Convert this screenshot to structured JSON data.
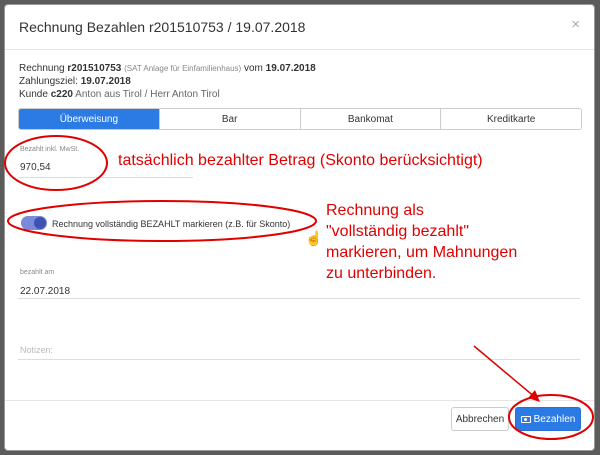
{
  "dialog": {
    "title": "Rechnung Bezahlen r201510753 / 19.07.2018",
    "close_glyph": "×"
  },
  "info": {
    "invoice_prefix": "Rechnung ",
    "invoice_number": "r201510753",
    "invoice_desc": "(SAT Anlage für Einfamilienhaus)",
    "invoice_from": " vom ",
    "invoice_date": "19.07.2018",
    "due_label": "Zahlungsziel: ",
    "due_date": "19.07.2018",
    "customer_label": "Kunde ",
    "customer_id": "c220",
    "customer_name": " Anton aus Tirol / Herr Anton Tirol"
  },
  "tabs": [
    {
      "label": "Überweisung",
      "active": true
    },
    {
      "label": "Bar",
      "active": false
    },
    {
      "label": "Bankomat",
      "active": false
    },
    {
      "label": "Kreditkarte",
      "active": false
    }
  ],
  "form": {
    "amount_label": "Bezahlt inkl. MwSt.",
    "amount_value": "970,54",
    "toggle_label": "Rechnung vollständig BEZAHLT markieren (z.B. für Skonto)",
    "toggle_on": true,
    "paid_on_label": "bezahlt am",
    "paid_on_value": "22.07.2018",
    "notes_placeholder": "Notizen:"
  },
  "annotations": {
    "amount_note": "tatsächlich bezahlter Betrag (Skonto berücksichtigt)",
    "toggle_note_1": "Rechnung als",
    "toggle_note_2": "\"vollständig bezahlt\"",
    "toggle_note_3": "markieren, um Mahnungen",
    "toggle_note_4": "zu unterbinden.",
    "color": "#e10000"
  },
  "buttons": {
    "cancel": "Abbrechen",
    "pay": "Bezahlen"
  },
  "colors": {
    "primary": "#2c7be5",
    "toggle": "#3f51b5"
  }
}
